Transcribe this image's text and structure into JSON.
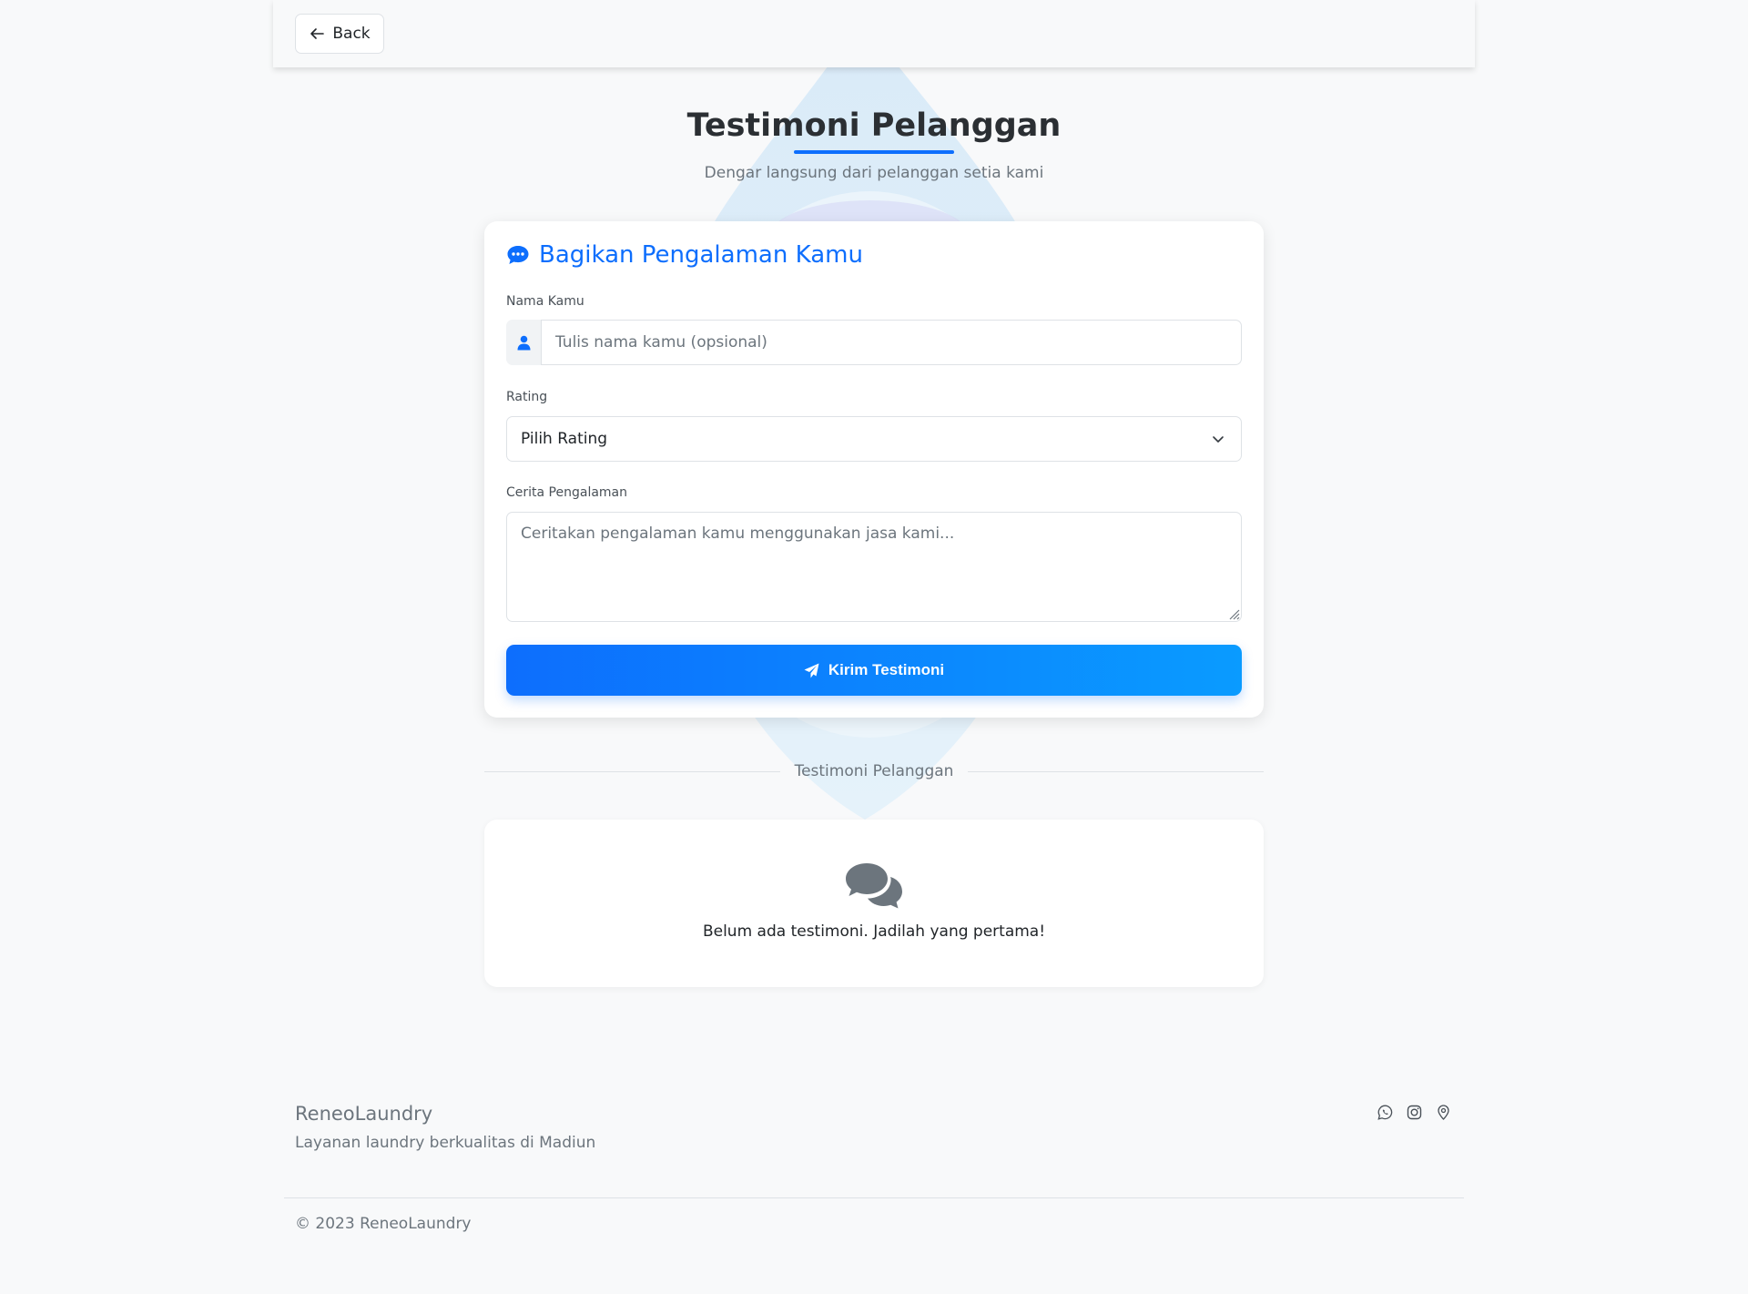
{
  "nav": {
    "back_label": "Back",
    "back_icon": "arrow-left-icon"
  },
  "header": {
    "title": "Testimoni Pelanggan",
    "subtitle": "Dengar langsung dari pelanggan setia kami"
  },
  "form": {
    "heading": "Bagikan Pengalaman Kamu",
    "heading_icon": "chat-dots-icon",
    "name_label": "Nama Kamu",
    "name_placeholder": "Tulis nama kamu (opsional)",
    "name_value": "",
    "name_icon": "person-icon",
    "rating_label": "Rating",
    "rating_selected": "Pilih Rating",
    "story_label": "Cerita Pengalaman",
    "story_placeholder": "Ceritakan pengalaman kamu menggunakan jasa kami...",
    "story_value": "",
    "submit_label": "Kirim Testimoni",
    "submit_icon": "send-icon"
  },
  "testimonials": {
    "divider_label": "Testimoni Pelanggan",
    "empty_icon": "chat-bubbles-icon",
    "empty_message": "Belum ada testimoni. Jadilah yang pertama!"
  },
  "footer": {
    "brand": "ReneoLaundry",
    "tagline": "Layanan laundry berkualitas di Madiun",
    "icons": [
      "whatsapp-icon",
      "instagram-icon",
      "location-pin-icon"
    ],
    "copyright": "© 2023 ReneoLaundry"
  },
  "colors": {
    "accent": "#0d6efd",
    "accent_gradient_end": "#0a9bff",
    "background": "#f8f9fa",
    "muted_text": "#6c757d"
  }
}
